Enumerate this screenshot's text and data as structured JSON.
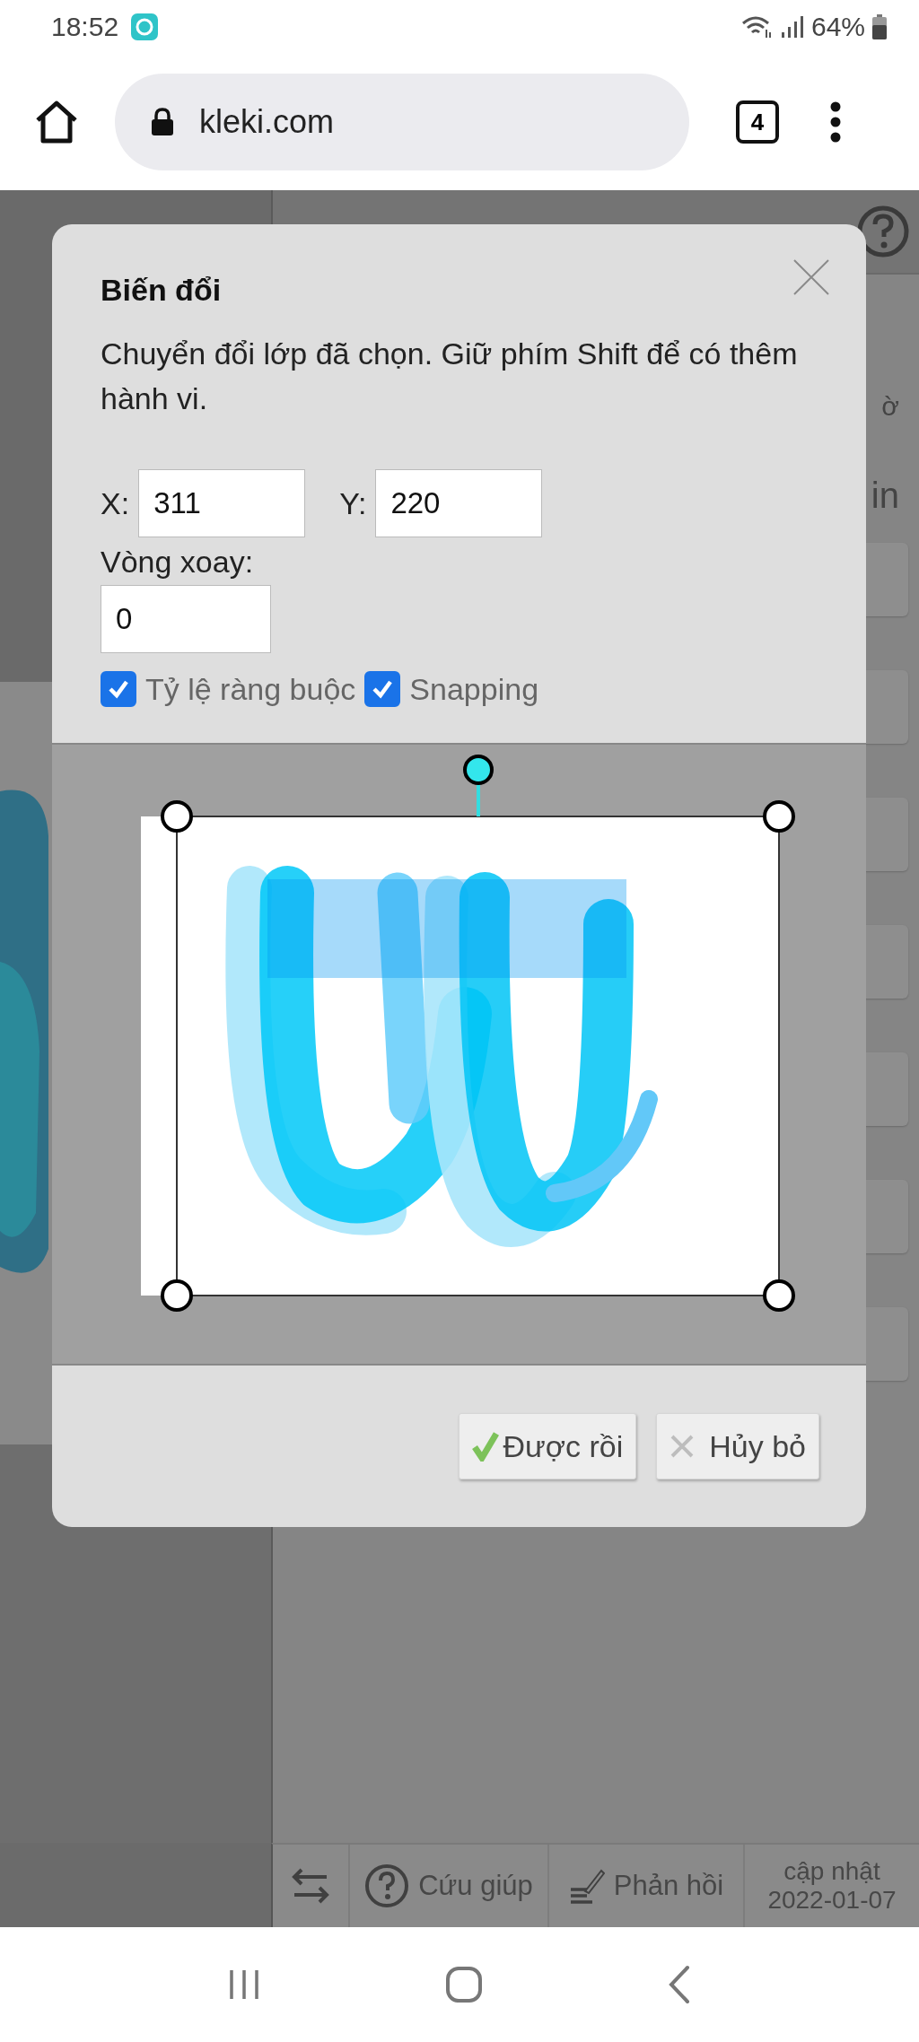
{
  "status_bar": {
    "time": "18:52",
    "battery": "64%"
  },
  "browser": {
    "url": "kleki.com",
    "tab_count": "4"
  },
  "sidebar": {
    "fragments": [
      "ờ",
      "in"
    ]
  },
  "dialog": {
    "title": "Biến đổi",
    "description": "Chuyển đổi lớp đã chọn. Giữ phím Shift để có thêm hành vi.",
    "fields": [
      {
        "label": "X:",
        "value": "311"
      },
      {
        "label": "Y:",
        "value": "220"
      }
    ],
    "rotation": {
      "label": "Vòng xoay:",
      "value": "0"
    },
    "options": [
      {
        "label": "Tỷ lệ ràng buộc",
        "checked": true
      },
      {
        "label": "Snapping",
        "checked": true
      }
    ],
    "buttons": [
      {
        "kind": "ok",
        "label": "Được rồi"
      },
      {
        "kind": "cancel",
        "label": "Hủy bỏ"
      }
    ]
  },
  "bottom_bar": {
    "help": "Cứu giúp",
    "feedback": "Phản hồi",
    "update_label": "cập nhật",
    "update_date": "2022-01-07"
  }
}
